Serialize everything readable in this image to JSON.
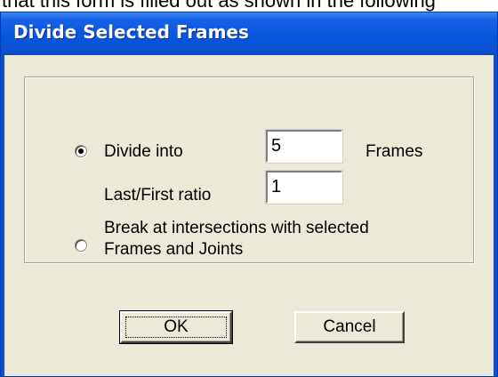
{
  "caption": "that this form is filled out as shown in the following",
  "dialog": {
    "title": "Divide Selected Frames",
    "option_divide": {
      "label": "Divide into",
      "selected": true,
      "value": "5",
      "unit": "Frames"
    },
    "ratio": {
      "label": "Last/First ratio",
      "value": "1"
    },
    "option_break": {
      "label_line1": "Break at intersections with selected",
      "label_line2": "Frames and Joints",
      "selected": false
    },
    "buttons": {
      "ok": "OK",
      "cancel": "Cancel"
    }
  }
}
